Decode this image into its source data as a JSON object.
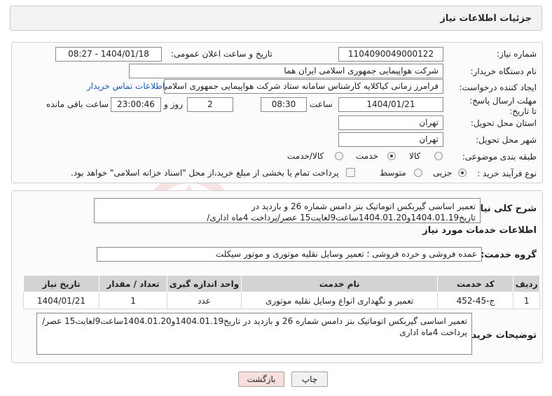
{
  "header": {
    "title": "جزئیات اطلاعات نیاز"
  },
  "form": {
    "need_number_label": "شماره نیاز:",
    "need_number": "1104090049000122",
    "announce_label": "تاریخ و ساعت اعلان عمومی:",
    "announce_value": "1404/01/18 - 08:27",
    "buyer_label": "نام دستگاه خریدار:",
    "buyer_value": "شرکت هواپیمایی جمهوری اسلامی ایران هما",
    "creator_label": "ایجاد کننده درخواست:",
    "creator_value": "فرامرز زمانی کیاکلایه کارشناس سامانه ستاد شرکت هواپیمایی جمهوری اسلامی ایران هما",
    "contact_link": "اطلاعات تماس خریدار",
    "deadline_label": "مهلت ارسال پاسخ: تا تاریخ:",
    "deadline_date": "1404/01/21",
    "time_label": "ساعت",
    "deadline_time": "08:30",
    "days_value": "2",
    "days_label": "روز و",
    "remaining_value": "23:00:46",
    "remaining_label": "ساعت باقی مانده",
    "province_label": "استان محل تحویل:",
    "province_value": "تهران",
    "city_label": "شهر محل تحویل:",
    "city_value": "تهران",
    "category_label": "طبقه بندی موضوعی:",
    "category_options": [
      "کالا",
      "خدمت",
      "کالا/خدمت"
    ],
    "category_selected": "خدمت",
    "process_label": "نوع فرآیند خرید :",
    "process_options": [
      "جزیی",
      "متوسط"
    ],
    "process_selected": "جزیی",
    "payment_note": "پرداخت تمام یا بخشی از مبلغ خرید،از محل \"اسناد خزانه اسلامی\" خواهد بود."
  },
  "summary": {
    "label": "شرح کلی نیاز:",
    "text": "تعمیر اساسی گیربکس اتوماتیک بنز دامس شماره 26 و بازدید در تاریخ1404.01.19و1404.01.20ساعت9لغایت15 عصر/پرداخت 4ماه اداری/"
  },
  "services": {
    "title": "اطلاعات خدمات مورد نیاز",
    "group_label": "گروه خدمت:",
    "group_value": "عمده فروشی و خرده فروشی ؛ تعمیر وسایل نقلیه موتوری و موتور سیکلت",
    "columns": [
      "ردیف",
      "کد خدمت",
      "نام خدمت",
      "واحد اندازه گیری",
      "تعداد / مقدار",
      "تاریخ نیاز"
    ],
    "rows": [
      [
        "1",
        "ج-45-452",
        "تعمیر و نگهداری انواع وسایل نقلیه موتوری",
        "عدد",
        "1",
        "1404/01/21"
      ]
    ]
  },
  "buyer_notes": {
    "label": "توضیحات خریدار:",
    "text": "تعمیر اساسی گیربکس اتوماتیک بنز دامس شماره 26 و بازدید در تاریخ1404.01.19و1404.01.20ساعت9لغایت15 عصر/پرداخت 4ماه اداری"
  },
  "buttons": {
    "print": "چاپ",
    "back": "بازگشت"
  },
  "colors": {
    "back_button_bg": "#f9dede",
    "header_bg": "#f3f3f3",
    "table_header_bg": "#d3d3d3",
    "link": "#1a5ab8"
  }
}
